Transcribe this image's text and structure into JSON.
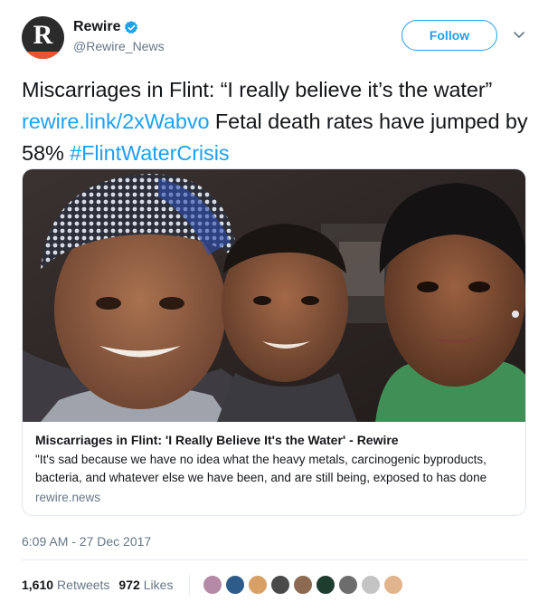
{
  "account": {
    "display_name": "Rewire",
    "handle": "@Rewire_News",
    "avatar_letter": "R",
    "verified": true
  },
  "follow_button": {
    "label": "Follow"
  },
  "tweet": {
    "text_before": "Miscarriages in Flint: “I really believe it’s the water” ",
    "link": "rewire.link/2xWabvo",
    "text_middle": " Fetal death rates have jumped by 58% ",
    "hashtag": "#FlintWaterCrisis"
  },
  "card": {
    "image_icon": "family-photo",
    "title": "Miscarriages in Flint: 'I Really Believe It's the Water' - Rewire",
    "description": "\"It's sad because we have no idea what the heavy metals, carcinogenic byproducts, bacteria, and whatever else we have been, and are still being, exposed to has done",
    "domain": "rewire.news"
  },
  "timestamp": "6:09 AM - 27 Dec 2017",
  "stats": {
    "retweets_count": "1,610",
    "retweets_label": "Retweets",
    "likes_count": "972",
    "likes_label": "Likes"
  },
  "colors": {
    "accent": "#1da1f2",
    "secondary_text": "#657786",
    "avatar_band": "#e8562a"
  }
}
